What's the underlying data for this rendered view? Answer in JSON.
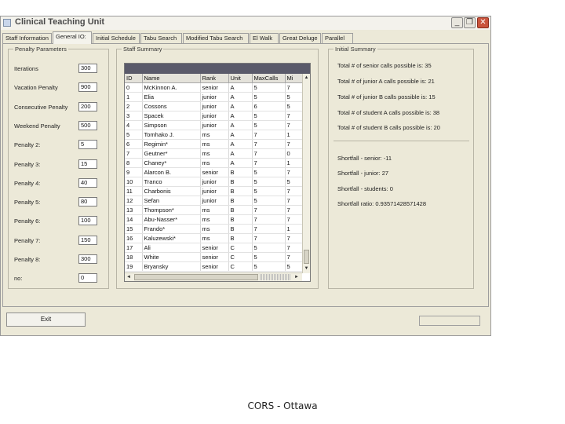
{
  "window": {
    "title": "Clinical Teaching Unit",
    "min": "_",
    "max": "❐",
    "close": "✕"
  },
  "tabs": [
    "Staff Information",
    "General IO:",
    "Initial Schedule",
    "Tabu Search",
    "Modified Tabu Search",
    "El Walk",
    "Great Deluge",
    "Parallel"
  ],
  "penalty": {
    "legend": "Penalty Parameters",
    "rows": [
      {
        "label": "Iterations",
        "value": "300"
      },
      {
        "label": "Vacation Penalty",
        "value": "900"
      },
      {
        "label": "Consecutive Penalty",
        "value": "200"
      },
      {
        "label": "Weekend Penalty",
        "value": "500"
      },
      {
        "label": "Penalty 2:",
        "value": "5"
      },
      {
        "label": "Penalty 3:",
        "value": "15"
      },
      {
        "label": "Penalty 4:",
        "value": "40"
      },
      {
        "label": "Penalty 5:",
        "value": "80"
      },
      {
        "label": "Penalty 6:",
        "value": "100"
      },
      {
        "label": "Penalty 7:",
        "value": "150"
      },
      {
        "label": "Penalty 8:",
        "value": "300"
      },
      {
        "label": "no:",
        "value": "0"
      }
    ]
  },
  "staff": {
    "legend": "Staff Summary",
    "columns": [
      "ID",
      "Name",
      "Rank",
      "Unit",
      "MaxCalls",
      "Mi"
    ],
    "rows": [
      [
        "0",
        "McKinnon A.",
        "senior",
        "A",
        "5",
        "7"
      ],
      [
        "1",
        "Elia",
        "junior",
        "A",
        "5",
        "5"
      ],
      [
        "2",
        "Cossons",
        "junior",
        "A",
        "6",
        "5"
      ],
      [
        "3",
        "Spacek",
        "junior",
        "A",
        "5",
        "7"
      ],
      [
        "4",
        "Simpson",
        "junior",
        "A",
        "5",
        "7"
      ],
      [
        "5",
        "Tomhako J.",
        "ms",
        "A",
        "7",
        "1"
      ],
      [
        "6",
        "Regimin*",
        "ms",
        "A",
        "7",
        "7"
      ],
      [
        "7",
        "Geutner*",
        "ms",
        "A",
        "7",
        "0"
      ],
      [
        "8",
        "Chaney*",
        "ms",
        "A",
        "7",
        "1"
      ],
      [
        "9",
        "Alarcon B.",
        "senior",
        "B",
        "5",
        "7"
      ],
      [
        "10",
        "Tranco",
        "junior",
        "B",
        "5",
        "5"
      ],
      [
        "11",
        "Charbonis",
        "junior",
        "B",
        "5",
        "7"
      ],
      [
        "12",
        "Sefan",
        "junior",
        "B",
        "5",
        "7"
      ],
      [
        "13",
        "Thompson*",
        "ms",
        "B",
        "7",
        "7"
      ],
      [
        "14",
        "Abu-Nasser*",
        "ms",
        "B",
        "7",
        "7"
      ],
      [
        "15",
        "Frando*",
        "ms",
        "B",
        "7",
        "1"
      ],
      [
        "16",
        "Kaluzewski*",
        "ms",
        "B",
        "7",
        "7"
      ],
      [
        "17",
        "Ali",
        "senior",
        "C",
        "5",
        "7"
      ],
      [
        "18",
        "White",
        "senior",
        "C",
        "5",
        "7"
      ],
      [
        "19",
        "Bryansky",
        "senior",
        "C",
        "5",
        "5"
      ]
    ]
  },
  "summary": {
    "legend": "Initial Summary",
    "lines": [
      "Total # of senior calls possible is: 35",
      "Total # of junior A calls possible is: 21",
      "Total # of junior B calls possible is: 15",
      "Total # of student A calls possible is: 38",
      "Total # of student B calls possible is: 20"
    ],
    "shortfall": [
      "Shortfall - senior: -11",
      "Shortfall - junior: 27",
      "Shortfall - students: 0",
      "Shortfall ratio: 0.93571428571428"
    ]
  },
  "footer": {
    "exit": "Exit"
  },
  "caption": "CORS - Ottawa"
}
